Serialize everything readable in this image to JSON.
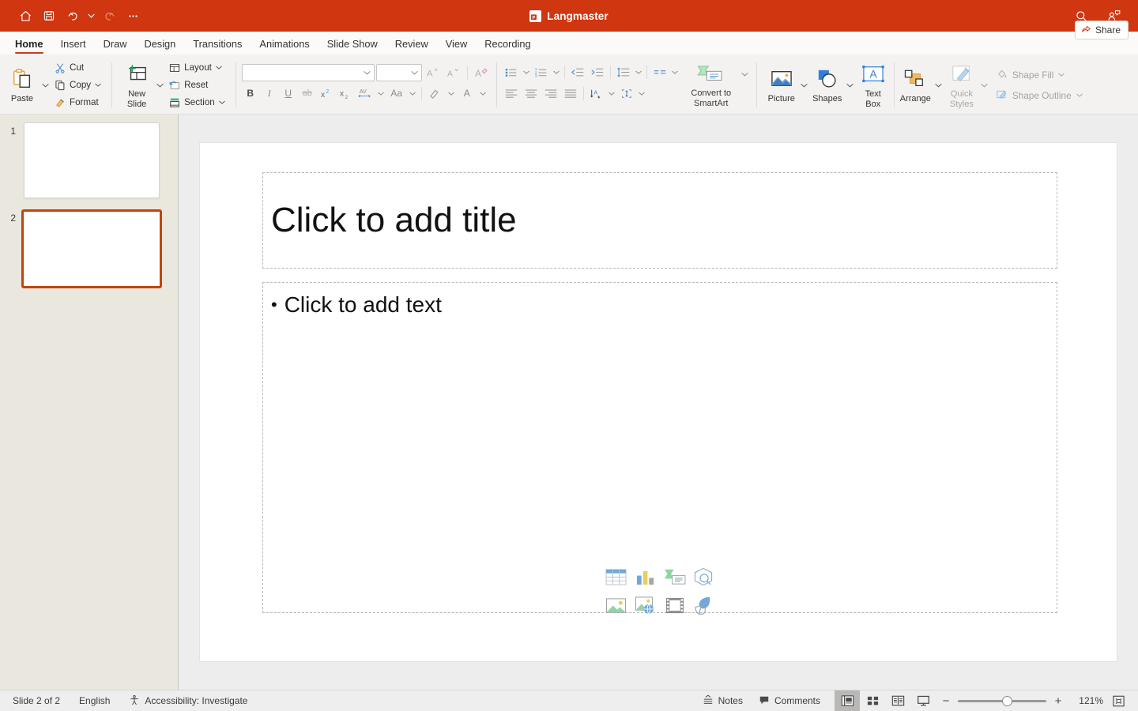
{
  "titlebar": {
    "app_title": "Langmaster",
    "file_type_badge": "P",
    "quick_access": [
      {
        "name": "home-icon",
        "label": "Home"
      },
      {
        "name": "save-icon",
        "label": "Save"
      },
      {
        "name": "undo-icon",
        "label": "Undo"
      },
      {
        "name": "undo-dropdown-caret-icon",
        "label": "Undo options"
      },
      {
        "name": "redo-icon",
        "label": "Redo"
      },
      {
        "name": "more-options-icon",
        "label": "More Options"
      }
    ],
    "right_icons": [
      {
        "name": "search-icon",
        "label": "Search"
      },
      {
        "name": "account-icon",
        "label": "Account"
      }
    ]
  },
  "tabs": {
    "items": [
      "Home",
      "Insert",
      "Draw",
      "Design",
      "Transitions",
      "Animations",
      "Slide Show",
      "Review",
      "View",
      "Recording"
    ],
    "active": "Home",
    "share_label": "Share"
  },
  "ribbon": {
    "clipboard": {
      "paste_label": "Paste",
      "cut_label": "Cut",
      "copy_label": "Copy",
      "format_label": "Format"
    },
    "slides": {
      "new_slide_label": "New\nSlide",
      "new_slide_line1": "New",
      "new_slide_line2": "Slide",
      "layout_label": "Layout",
      "reset_label": "Reset",
      "section_label": "Section"
    },
    "font": {
      "font_name_value": "",
      "font_name_placeholder": "",
      "font_size_value": "",
      "font_size_placeholder": "",
      "buttons": [
        "increase-font-size",
        "decrease-font-size",
        "clear-formatting",
        "bold",
        "italic",
        "underline",
        "strikethrough",
        "superscript",
        "subscript",
        "character-spacing",
        "change-case",
        "text-highlight-color",
        "font-color"
      ]
    },
    "paragraph": {
      "buttons": [
        "bullets",
        "numbering",
        "decrease-indent",
        "increase-indent",
        "line-spacing",
        "columns",
        "align-left",
        "align-center",
        "align-right",
        "justify",
        "text-direction",
        "align-text"
      ],
      "convert_smartart_line1": "Convert to",
      "convert_smartart_line2": "SmartArt"
    },
    "drawing": {
      "picture_label": "Picture",
      "shapes_label": "Shapes",
      "textbox_line1": "Text",
      "textbox_line2": "Box",
      "arrange_label": "Arrange",
      "quick_styles_line1": "Quick",
      "quick_styles_line2": "Styles",
      "shape_fill_label": "Shape Fill",
      "shape_outline_label": "Shape Outline"
    }
  },
  "thumbnails": {
    "slides": [
      {
        "number": "1",
        "selected": false
      },
      {
        "number": "2",
        "selected": true
      }
    ]
  },
  "slide": {
    "title_placeholder": "Click to add title",
    "body_bullet": "•",
    "body_placeholder": "Click to add text",
    "content_icons": [
      {
        "name": "insert-table-icon",
        "label": "Insert Table"
      },
      {
        "name": "insert-chart-icon",
        "label": "Insert Chart"
      },
      {
        "name": "insert-smartart-icon",
        "label": "Insert SmartArt Graphic"
      },
      {
        "name": "insert-3d-model-icon",
        "label": "Insert 3D Model"
      },
      {
        "name": "insert-picture-icon",
        "label": "Pictures"
      },
      {
        "name": "insert-online-picture-icon",
        "label": "Online Pictures"
      },
      {
        "name": "insert-video-icon",
        "label": "Insert Video"
      },
      {
        "name": "insert-icon-icon",
        "label": "Insert Icon"
      }
    ]
  },
  "statusbar": {
    "slide_indicator": "Slide 2 of 2",
    "language": "English",
    "accessibility": "Accessibility: Investigate",
    "notes_label": "Notes",
    "comments_label": "Comments",
    "views": [
      {
        "name": "normal-view",
        "label": "Normal",
        "active": true
      },
      {
        "name": "slide-sorter-view",
        "label": "Slide Sorter",
        "active": false
      },
      {
        "name": "reading-view",
        "label": "Reading View",
        "active": false
      },
      {
        "name": "slide-show-view",
        "label": "Slide Show",
        "active": false
      }
    ],
    "zoom_out": "−",
    "zoom_in": "+",
    "zoom_level": "121%",
    "fit_label": "Fit slide to current window"
  },
  "colors": {
    "titlebar": "#d03610",
    "accent": "#c43e1c",
    "selection": "#c1440e",
    "ribbon_bg": "#f3f2f1",
    "thumbpane_bg": "#eae8de",
    "workspace_bg": "#ededed",
    "statusbar_bg": "#eeeeee"
  }
}
